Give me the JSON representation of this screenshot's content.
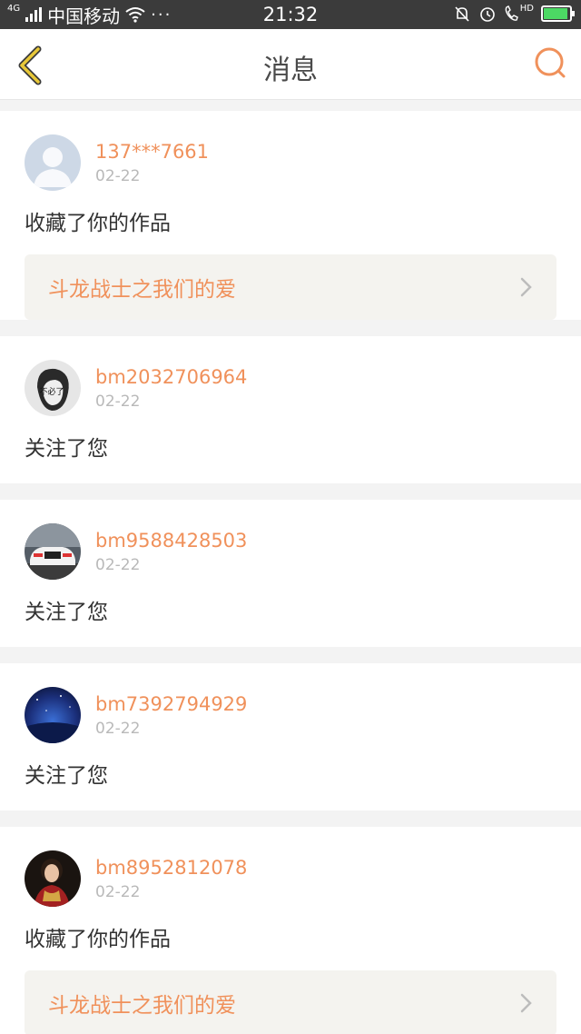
{
  "status_bar": {
    "network": "4G",
    "carrier": "中国移动",
    "more": "···",
    "time": "21:32",
    "hd": "HD"
  },
  "header": {
    "title": "消息"
  },
  "messages": [
    {
      "username": "137***7661",
      "date": "02-22",
      "action": "收藏了你的作品",
      "work_title": "斗龙战士之我们的爱"
    },
    {
      "username": "bm2032706964",
      "date": "02-22",
      "action": "关注了您"
    },
    {
      "username": "bm9588428503",
      "date": "02-22",
      "action": "关注了您"
    },
    {
      "username": "bm7392794929",
      "date": "02-22",
      "action": "关注了您"
    },
    {
      "username": "bm8952812078",
      "date": "02-22",
      "action": "收藏了你的作品",
      "work_title": "斗龙战士之我们的爱"
    }
  ],
  "avatar_labels": {
    "bm2032706964": "不必了"
  },
  "colors": {
    "accent": "#f0915b",
    "back_icon": "#e8c838",
    "status_bar": "#3b3b3b"
  }
}
